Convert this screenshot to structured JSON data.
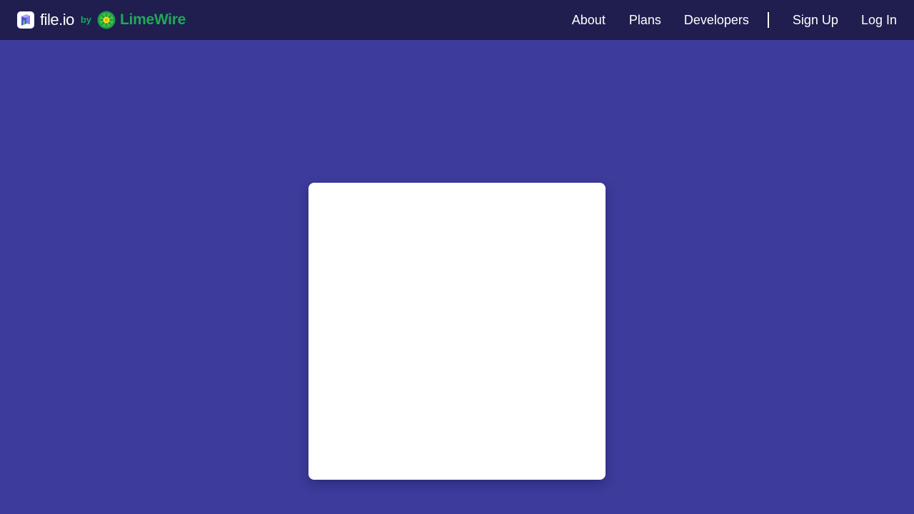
{
  "header": {
    "brand": {
      "name": "file.io",
      "by": "by",
      "partner": "LimeWire"
    },
    "nav": {
      "about": "About",
      "plans": "Plans",
      "developers": "Developers",
      "sign_up": "Sign Up",
      "log_in": "Log In"
    }
  },
  "colors": {
    "page_background": "#3d3b9b",
    "navbar_background": "#1f1e4e",
    "partner_green": "#1fa85a",
    "card_background": "#ffffff"
  },
  "icons": {
    "brand_logo": "fileio-logo-icon",
    "partner_logo": "limewire-logo-icon"
  }
}
